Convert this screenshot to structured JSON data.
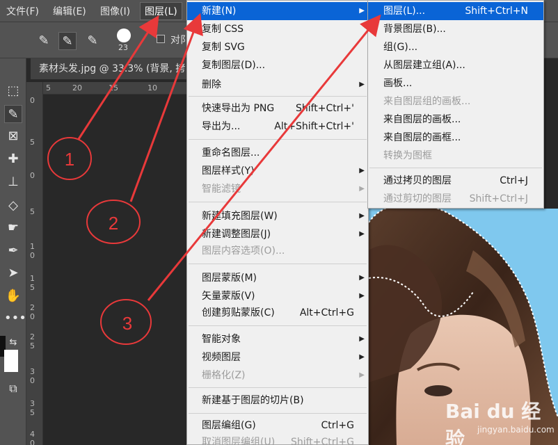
{
  "menubar": {
    "items": [
      {
        "label": "文件(F)"
      },
      {
        "label": "编辑(E)"
      },
      {
        "label": "图像(I)"
      },
      {
        "label": "图层(L)"
      }
    ]
  },
  "options": {
    "brush_size": "23",
    "checkbox_label": "对阝"
  },
  "document": {
    "tab_title": "素材头发.jpg @ 33.3% (背景, 拷",
    "ruler_h": [
      "5",
      "20",
      "15",
      "10"
    ],
    "ruler_v": [
      "0",
      "5",
      "0",
      "5",
      "1 0",
      "1 5",
      "2 0",
      "2 5",
      "3 0",
      "3 5",
      "4 0"
    ]
  },
  "layer_menu": {
    "items": [
      {
        "label": "新建(N)",
        "shortcut": "",
        "submenu": true,
        "disabled": false,
        "highlighted": true
      },
      {
        "label": "复制 CSS",
        "shortcut": "",
        "submenu": false,
        "disabled": false
      },
      {
        "label": "复制 SVG",
        "shortcut": "",
        "submenu": false,
        "disabled": false
      },
      {
        "label": "复制图层(D)...",
        "shortcut": "",
        "submenu": false,
        "disabled": false
      },
      {
        "label": "删除",
        "shortcut": "",
        "submenu": true,
        "disabled": false
      },
      {
        "label": "快速导出为 PNG",
        "shortcut": "Shift+Ctrl+'",
        "submenu": false,
        "disabled": false
      },
      {
        "label": "导出为...",
        "shortcut": "Alt+Shift+Ctrl+'",
        "submenu": false,
        "disabled": false
      },
      {
        "label": "重命名图层...",
        "shortcut": "",
        "submenu": false,
        "disabled": false
      },
      {
        "label": "图层样式(Y)",
        "shortcut": "",
        "submenu": true,
        "disabled": false
      },
      {
        "label": "智能滤镜",
        "shortcut": "",
        "submenu": true,
        "disabled": true
      },
      {
        "label": "新建填充图层(W)",
        "shortcut": "",
        "submenu": true,
        "disabled": false
      },
      {
        "label": "新建调整图层(J)",
        "shortcut": "",
        "submenu": true,
        "disabled": false
      },
      {
        "label": "图层内容选项(O)...",
        "shortcut": "",
        "submenu": false,
        "disabled": true
      },
      {
        "label": "图层蒙版(M)",
        "shortcut": "",
        "submenu": true,
        "disabled": false
      },
      {
        "label": "矢量蒙版(V)",
        "shortcut": "",
        "submenu": true,
        "disabled": false
      },
      {
        "label": "创建剪贴蒙版(C)",
        "shortcut": "Alt+Ctrl+G",
        "submenu": false,
        "disabled": false
      },
      {
        "label": "智能对象",
        "shortcut": "",
        "submenu": true,
        "disabled": false
      },
      {
        "label": "视频图层",
        "shortcut": "",
        "submenu": true,
        "disabled": false
      },
      {
        "label": "栅格化(Z)",
        "shortcut": "",
        "submenu": true,
        "disabled": true
      },
      {
        "label": "新建基于图层的切片(B)",
        "shortcut": "",
        "submenu": false,
        "disabled": false
      },
      {
        "label": "图层编组(G)",
        "shortcut": "Ctrl+G",
        "submenu": false,
        "disabled": false
      },
      {
        "label": "取消图层编组(U)",
        "shortcut": "Shift+Ctrl+G",
        "submenu": false,
        "disabled": true
      }
    ]
  },
  "new_submenu": {
    "items": [
      {
        "label": "图层(L)...",
        "shortcut": "Shift+Ctrl+N",
        "disabled": false,
        "highlighted": true
      },
      {
        "label": "背景图层(B)...",
        "shortcut": "",
        "disabled": false
      },
      {
        "label": "组(G)...",
        "shortcut": "",
        "disabled": false
      },
      {
        "label": "从图层建立组(A)...",
        "shortcut": "",
        "disabled": false
      },
      {
        "label": "画板...",
        "shortcut": "",
        "disabled": false
      },
      {
        "label": "来自图层组的画板...",
        "shortcut": "",
        "disabled": true
      },
      {
        "label": "来自图层的画板...",
        "shortcut": "",
        "disabled": false
      },
      {
        "label": "来自图层的画框...",
        "shortcut": "",
        "disabled": false
      },
      {
        "label": "转换为图框",
        "shortcut": "",
        "disabled": true
      },
      {
        "label": "通过拷贝的图层",
        "shortcut": "Ctrl+J",
        "disabled": false
      },
      {
        "label": "通过剪切的图层",
        "shortcut": "Shift+Ctrl+J",
        "disabled": true
      }
    ]
  },
  "annotations": {
    "labels": [
      "1",
      "2",
      "3"
    ],
    "color": "#e8393a"
  },
  "watermark": {
    "main": "Bai du 经验",
    "sub": "jingyan.baidu.com"
  },
  "colors": {
    "accent": "#0a64d6",
    "sky": "#7fc8ee"
  }
}
